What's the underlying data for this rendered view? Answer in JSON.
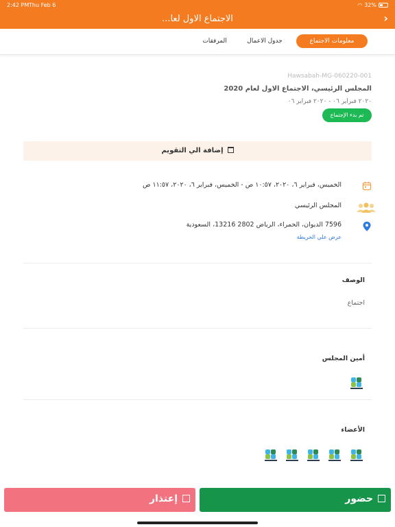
{
  "status": {
    "time": "2:42 PM",
    "date": "Thu Feb 6",
    "battery": "32%"
  },
  "header": {
    "title": "الاجتماع الاول لعا..."
  },
  "tabs": {
    "info": "معلومات الاجتماع",
    "agenda": "جدول الاعمال",
    "attachments": "المرفقات"
  },
  "meeting": {
    "code": "Hawsabah-MG-060220-001",
    "title": "المجلس الرئيسي، الاجتماع الاول لعام 2020",
    "dates": "٢٠٢٠ فبراير ٠٦ - ٢٠٢٠ فبراير ٠٦",
    "status_chip": "تم بدء الإجتماع"
  },
  "calendar": {
    "add_label": "إضافة الي التقويم"
  },
  "details": {
    "datetime": "الخميس، فبراير ٦، ٢٠٢٠، ١٠:٥٧ ص - الخميس، فبراير ٦، ٢٠٢٠، ١١:٥٧ ص",
    "council": "المجلس الرئيسي",
    "address": "7596 الديوان، الحمراء، الرياض 2802 13216، السعودية",
    "map_link": "عرض علي الخريطة"
  },
  "description": {
    "heading": "الوصف",
    "text": "اجتماع"
  },
  "secretary": {
    "heading": "أمين المجلس"
  },
  "members": {
    "heading": "الأعضاء",
    "count": 5
  },
  "actions": {
    "excuse": "إعتذار",
    "attend": "حضور"
  },
  "colors": {
    "brand": "#f47b20",
    "attend": "#16954a",
    "excuse": "#f3727f",
    "chip": "#1db954",
    "link": "#2f7be0"
  },
  "icons": {
    "back": "chevron-right-icon",
    "calendar": "calendar-icon",
    "group": "group-icon",
    "location": "location-pin-icon"
  }
}
